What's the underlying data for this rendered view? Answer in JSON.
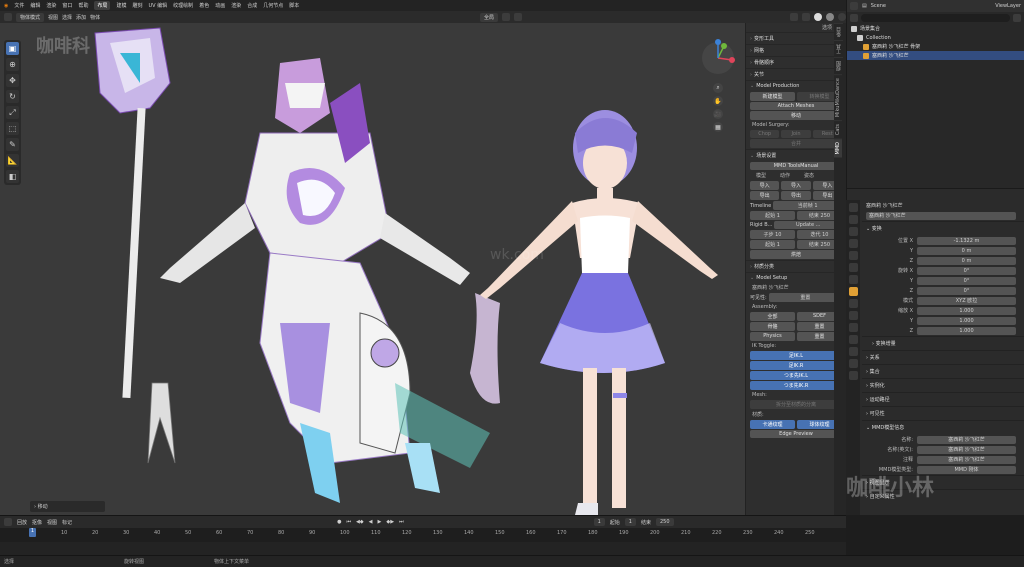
{
  "menus": [
    "文件",
    "编辑",
    "渲染",
    "窗口",
    "帮助"
  ],
  "workspaces": [
    "布局",
    "建模",
    "雕刻",
    "UV 编辑",
    "纹理绘制",
    "着色",
    "动画",
    "渲染",
    "合成",
    "几何节点",
    "脚本"
  ],
  "active_workspace": "布局",
  "scene": {
    "label": "Scene",
    "view_layer": "ViewLayer"
  },
  "viewport_header": {
    "mode": "物体模式",
    "menus": [
      "视图",
      "选择",
      "添加",
      "物体"
    ],
    "transform": "全局",
    "options": "选项"
  },
  "tools": [
    "select",
    "cursor",
    "move",
    "rotate",
    "scale",
    "transform",
    "annotate",
    "measure",
    "add-cube"
  ],
  "watermarks": {
    "top_left": "咖啡科",
    "center": "wk.com",
    "bottom_right": "咖啡小林"
  },
  "operator_panel": "移动",
  "npanel": {
    "tabs": [
      "MMD",
      "Cats",
      "MikuMikuDance",
      "视图",
      "工具",
      "条目"
    ],
    "sections_top": [
      "变形工具",
      "网格",
      "骨骼顺序",
      "关节"
    ],
    "model_production": {
      "title": "Model Production",
      "new_model": "新建模型",
      "convert": "转换模型",
      "attach": "Attach Meshes",
      "separate": "移动",
      "surgery": "Model Surgery:",
      "surgery_btns": [
        "Chop",
        "Join",
        "Rest"
      ],
      "merge": "合并"
    },
    "scene_setup": {
      "title": "场景设置",
      "manual": "MMD ToolsManual",
      "row1": [
        "模型",
        "动作",
        "姿态"
      ],
      "row2": [
        "导入",
        "导入",
        "导入"
      ],
      "row3": [
        "导出",
        "导出",
        "导出"
      ],
      "timeline": {
        "label": "Timeline",
        "current": "当前帧",
        "cur_val": "1",
        "start": "起始",
        "start_val": "1",
        "end": "结束",
        "end_val": "250"
      },
      "rigid": {
        "label": "Rigid B...",
        "update": "Update ...",
        "sub": "子步",
        "sub_val": "10",
        "iter": "迭代",
        "iter_val": "10",
        "start": "起始",
        "start_val": "1",
        "end": "结束",
        "end_val": "250",
        "bake": "烘焙"
      }
    },
    "mat_sort": "材质分类",
    "model_setup": {
      "title": "Model Setup",
      "model_name": "塞西莉 沙飞红芒",
      "visibility": "可见性:",
      "reset": "重置",
      "assembly": "Assembly:",
      "asm_row1": [
        "全部",
        "SDEF"
      ],
      "asm_row2": [
        "骨骼",
        "重置"
      ],
      "asm_row3": [
        "Physics",
        "重置"
      ],
      "ik_toggle": "IK Toggle:",
      "ik_items": [
        "足IK.L",
        "足IK.R",
        "つま先IK.L",
        "つま先IK.R"
      ],
      "mesh": "Mesh:",
      "mesh_btn": "拆分至材质的分离",
      "material": "材质:",
      "mat_btns": [
        "卡通纹理",
        "球体纹理"
      ],
      "edge": "Edge Preview"
    }
  },
  "outliner": {
    "root": "场景集合",
    "collection": "Collection",
    "items": [
      "塞西莉 沙飞红芒 骨架",
      "塞西莉 沙飞红芒"
    ]
  },
  "properties": {
    "object_name": "塞西莉 沙飞红芒",
    "object_field": "塞西莉 沙飞红芒",
    "transform": "变换",
    "location": {
      "label": "位置 X",
      "x": "-1.1322 m",
      "y": "0 m",
      "z": "0 m"
    },
    "rotation": {
      "label": "旋转 X",
      "x": "0°",
      "y": "0°",
      "z": "0°"
    },
    "mode": {
      "label": "模式",
      "value": "XYZ 欧拉"
    },
    "scale": {
      "label": "缩放 X",
      "x": "1.000",
      "y": "1.000",
      "z": "1.000"
    },
    "delta": "变换增量",
    "sections": [
      "关系",
      "集合",
      "实例化",
      "运动路径",
      "可见性"
    ],
    "mmd_title": "MMD模型信息",
    "mmd_name_k": "名称:",
    "mmd_name_v": "塞西莉 沙飞红芒",
    "mmd_name_en_k": "名称(英文):",
    "mmd_name_en_v": "塞西莉 沙飞红芒",
    "mmd_note": "注释",
    "mmd_type_k": "MMD模型类型:",
    "mmd_type_v": "MMD 刚体",
    "tail_sections": [
      "视图显示",
      "自定义属性"
    ],
    "axis_labels": [
      "Y",
      "Z"
    ]
  },
  "timeline": {
    "menus": [
      "回放",
      "抠像",
      "视图",
      "标记"
    ],
    "frame": "1",
    "start_label": "起始",
    "start": "1",
    "end_label": "结束",
    "end": "250",
    "ticks": [
      "1",
      "10",
      "20",
      "30",
      "40",
      "50",
      "60",
      "70",
      "80",
      "90",
      "100",
      "110",
      "120",
      "130",
      "140",
      "150",
      "160",
      "170",
      "180",
      "190",
      "200",
      "210",
      "220",
      "230",
      "240",
      "250"
    ]
  },
  "status": [
    "选择",
    "旋转视图",
    "物体上下文菜单"
  ]
}
